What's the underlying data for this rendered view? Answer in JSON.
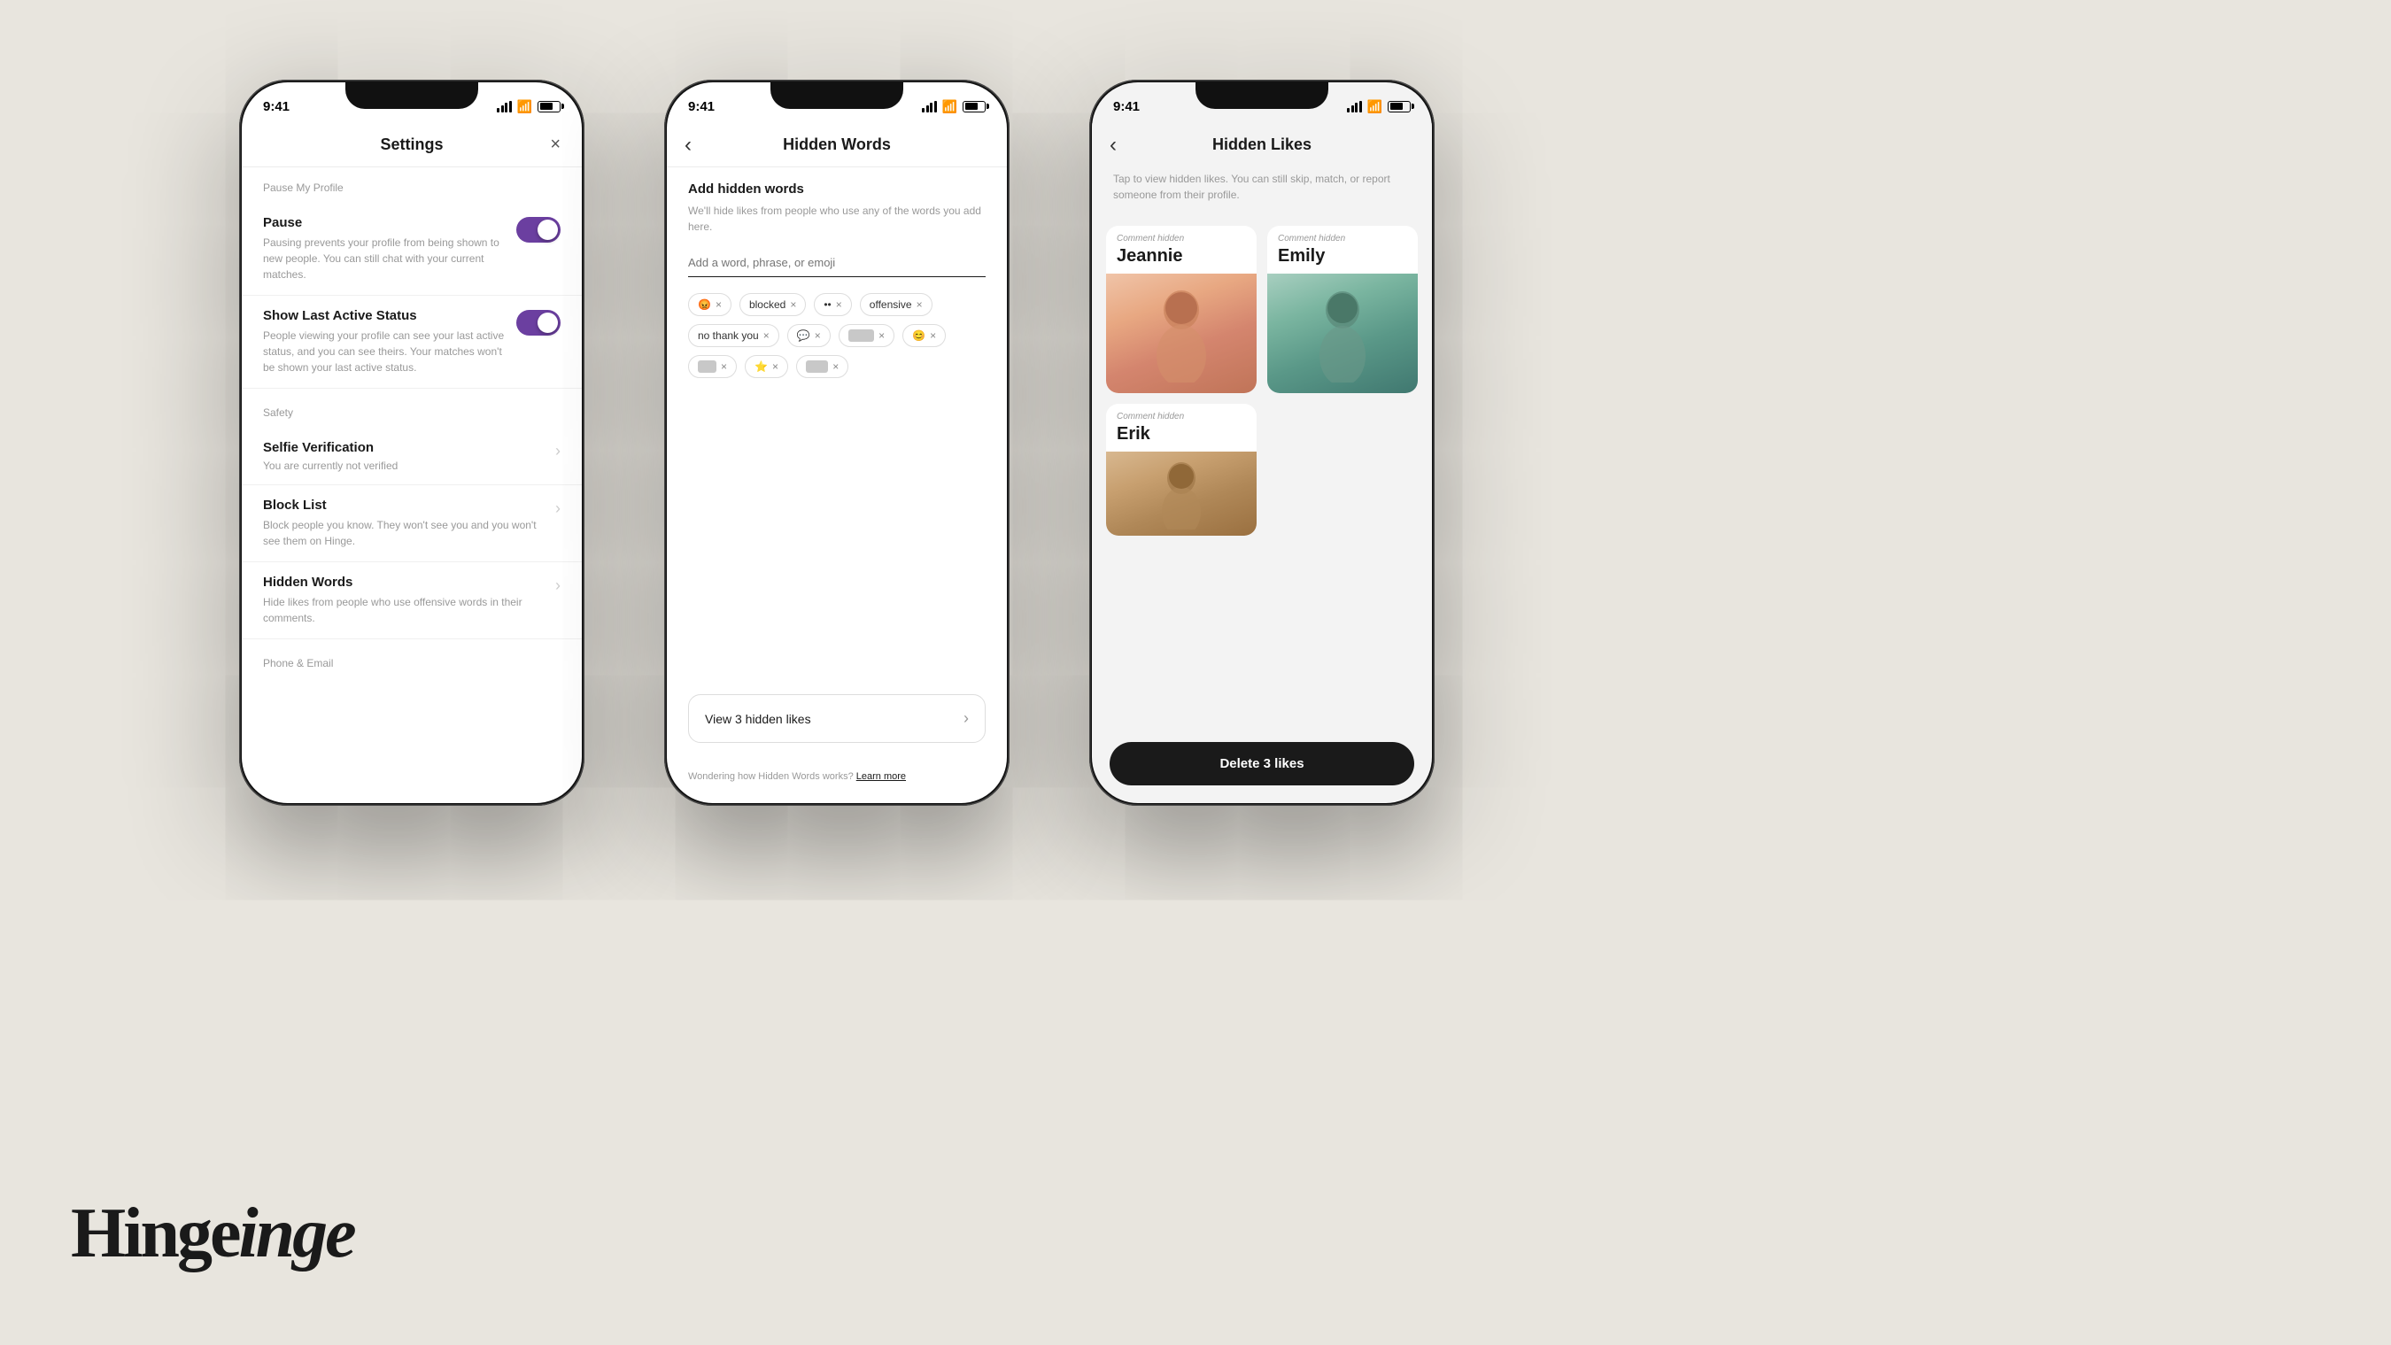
{
  "app": {
    "name": "Hinge",
    "brand_color": "#6b3fa0",
    "background_color": "#e8e5de"
  },
  "status_bar": {
    "time": "9:41",
    "signal_label": "signal",
    "wifi_label": "wifi",
    "battery_label": "battery"
  },
  "phone1": {
    "screen": "settings",
    "header": {
      "title": "Settings",
      "close_label": "×"
    },
    "sections": [
      {
        "label": "Pause My Profile",
        "items": [
          {
            "title": "Pause",
            "description": "Pausing prevents your profile from being shown to new people. You can still chat with your current matches.",
            "type": "toggle",
            "enabled": true
          },
          {
            "title": "Show Last Active Status",
            "description": "People viewing your profile can see your last active status, and you can see theirs. Your matches won't be shown your last active status.",
            "type": "toggle",
            "enabled": true
          }
        ]
      },
      {
        "label": "Safety",
        "items": [
          {
            "title": "Selfie Verification",
            "description": "You are currently not verified",
            "type": "nav"
          },
          {
            "title": "Block List",
            "description": "Block people you know. They won't see you and you won't see them on Hinge.",
            "type": "nav"
          },
          {
            "title": "Hidden Words",
            "description": "Hide likes from people who use offensive words in their comments.",
            "type": "nav"
          }
        ]
      },
      {
        "label": "Phone & Email",
        "items": []
      }
    ]
  },
  "phone2": {
    "screen": "hidden_words",
    "header": {
      "title": "Hidden Words",
      "back_label": "‹"
    },
    "add_section": {
      "title": "Add hidden words",
      "description": "We'll hide likes from people who use any of the words you add here.",
      "input_placeholder": "Add a word, phrase, or emoji"
    },
    "chips": [
      {
        "type": "emoji",
        "value": "😡",
        "has_x": true
      },
      {
        "type": "text",
        "value": "blocked",
        "has_x": true
      },
      {
        "type": "emoji",
        "value": "••",
        "has_x": true
      },
      {
        "type": "text",
        "value": "offensive",
        "has_x": true
      },
      {
        "type": "text",
        "value": "no thank you",
        "has_x": true
      },
      {
        "type": "emoji",
        "value": "💬",
        "has_x": true
      },
      {
        "type": "blurred",
        "value": "•••••••",
        "has_x": true
      },
      {
        "type": "emoji",
        "value": "😊",
        "has_x": true
      },
      {
        "type": "blurred",
        "value": "•••••",
        "has_x": true
      },
      {
        "type": "emoji",
        "value": "⭐",
        "has_x": true
      },
      {
        "type": "blurred",
        "value": "••••••",
        "has_x": true
      }
    ],
    "view_likes_button": "View 3 hidden likes",
    "wondering_text": "Wondering how Hidden Words works?",
    "learn_more": "Learn more"
  },
  "phone3": {
    "screen": "hidden_likes",
    "header": {
      "title": "Hidden Likes",
      "back_label": "‹"
    },
    "subtitle": "Tap to view hidden likes. You can still skip, match, or report someone from their profile.",
    "profiles": [
      {
        "name": "Jeannie",
        "comment_label": "Comment hidden",
        "photo_type": "jeannie"
      },
      {
        "name": "Emily",
        "comment_label": "Comment hidden",
        "photo_type": "emily"
      },
      {
        "name": "Erik",
        "comment_label": "Comment hidden",
        "photo_type": "erik"
      }
    ],
    "delete_button": "Delete 3 likes"
  }
}
